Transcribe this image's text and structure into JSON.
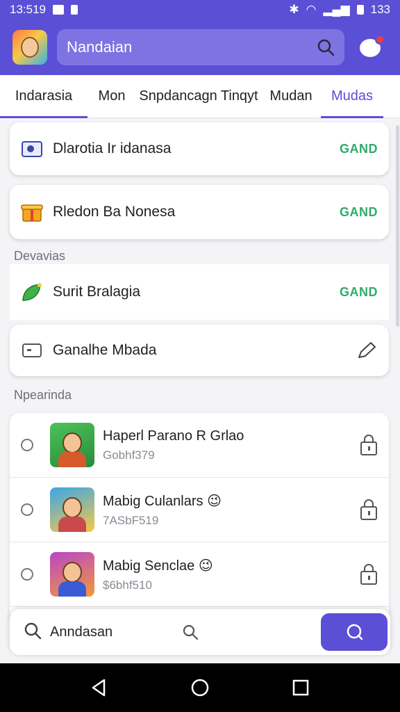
{
  "status": {
    "time": "13:519",
    "battery": "133"
  },
  "appbar": {
    "search_text": "Nandaian"
  },
  "tabs": [
    {
      "label": "Indarasia"
    },
    {
      "label": "Mon"
    },
    {
      "label": "Snpdancagn Tinqyt"
    },
    {
      "label": "Mudan"
    },
    {
      "label": "Mudas"
    }
  ],
  "cards": {
    "c1": {
      "label": "Dlarotia Ir idanasa",
      "badge": "GAND"
    },
    "c2": {
      "label": "Rledon Ba Nonesa",
      "badge": "GAND"
    },
    "c3": {
      "label": "Surit Bralagia",
      "badge": "GAND"
    },
    "c4": {
      "label": "Ganalhe Mbada"
    }
  },
  "sections": {
    "s1": "Devavias",
    "s2": "Npearinda"
  },
  "list": [
    {
      "name": "Haperl Parano R Grlao",
      "sub": "Gobhf379"
    },
    {
      "name": "Mabig Culanlars 😉",
      "sub": "7ASbF519"
    },
    {
      "name": "Mabig Senclae 😉",
      "sub": "$6bhf510"
    }
  ],
  "bottom": {
    "search_text": "Anndasan"
  },
  "colors": {
    "accent": "#5b4fd6",
    "badge_green": "#2eab6a"
  }
}
